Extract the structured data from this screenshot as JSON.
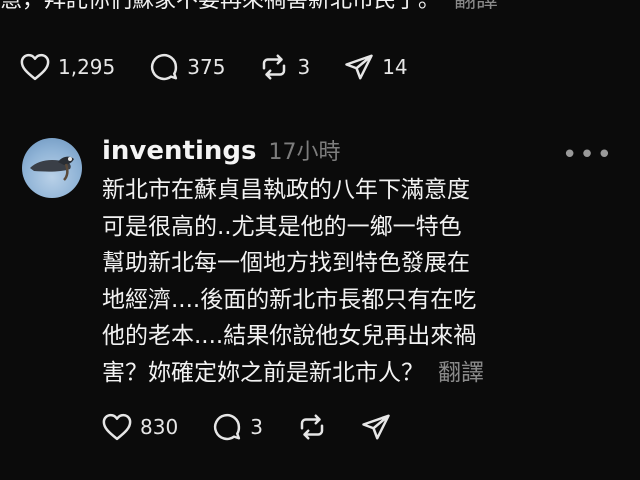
{
  "prev_post": {
    "text_tail": "慧，拜託你們蘇家不要再來禍害新北市民了。",
    "translate_label": "翻譯",
    "likes": "1,295",
    "comments": "375",
    "reposts": "3",
    "shares": "14"
  },
  "reply": {
    "username": "inventings",
    "time": "17小時",
    "lines": [
      "新北市在蘇貞昌執政的八年下滿意度",
      "可是很高的..尤其是他的一鄉一特色",
      "幫助新北每一個地方找到特色發展在",
      "地經濟....後面的新北市長都只有在吃",
      "他的老本....結果你說他女兒再出來禍",
      "害？妳確定妳之前是新北市人？"
    ],
    "translate_label": "翻譯",
    "likes": "830",
    "comments": "3"
  },
  "icons": [
    "heart-icon",
    "comment-icon",
    "repost-icon",
    "share-icon",
    "more-icon"
  ]
}
